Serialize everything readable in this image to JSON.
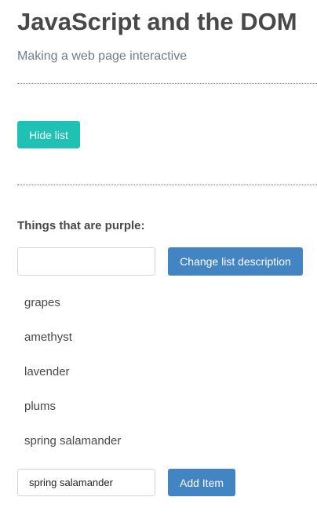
{
  "header": {
    "title": "JavaScript and the DOM",
    "subtitle": "Making a web page interactive"
  },
  "toggle": {
    "hide_label": "Hide list"
  },
  "description": {
    "heading": "Things that are purple:",
    "input_value": "",
    "button_label": "Change list description"
  },
  "list": {
    "items": [
      "grapes",
      "amethyst",
      "lavender",
      "plums",
      "spring salamander"
    ]
  },
  "add": {
    "input_value": "spring salamander",
    "button_label": "Add Item"
  },
  "colors": {
    "teal_button": "#1ec1b3",
    "blue_button": "#4384c3",
    "subtitle": "#6c7c8c",
    "text": "#484848"
  }
}
